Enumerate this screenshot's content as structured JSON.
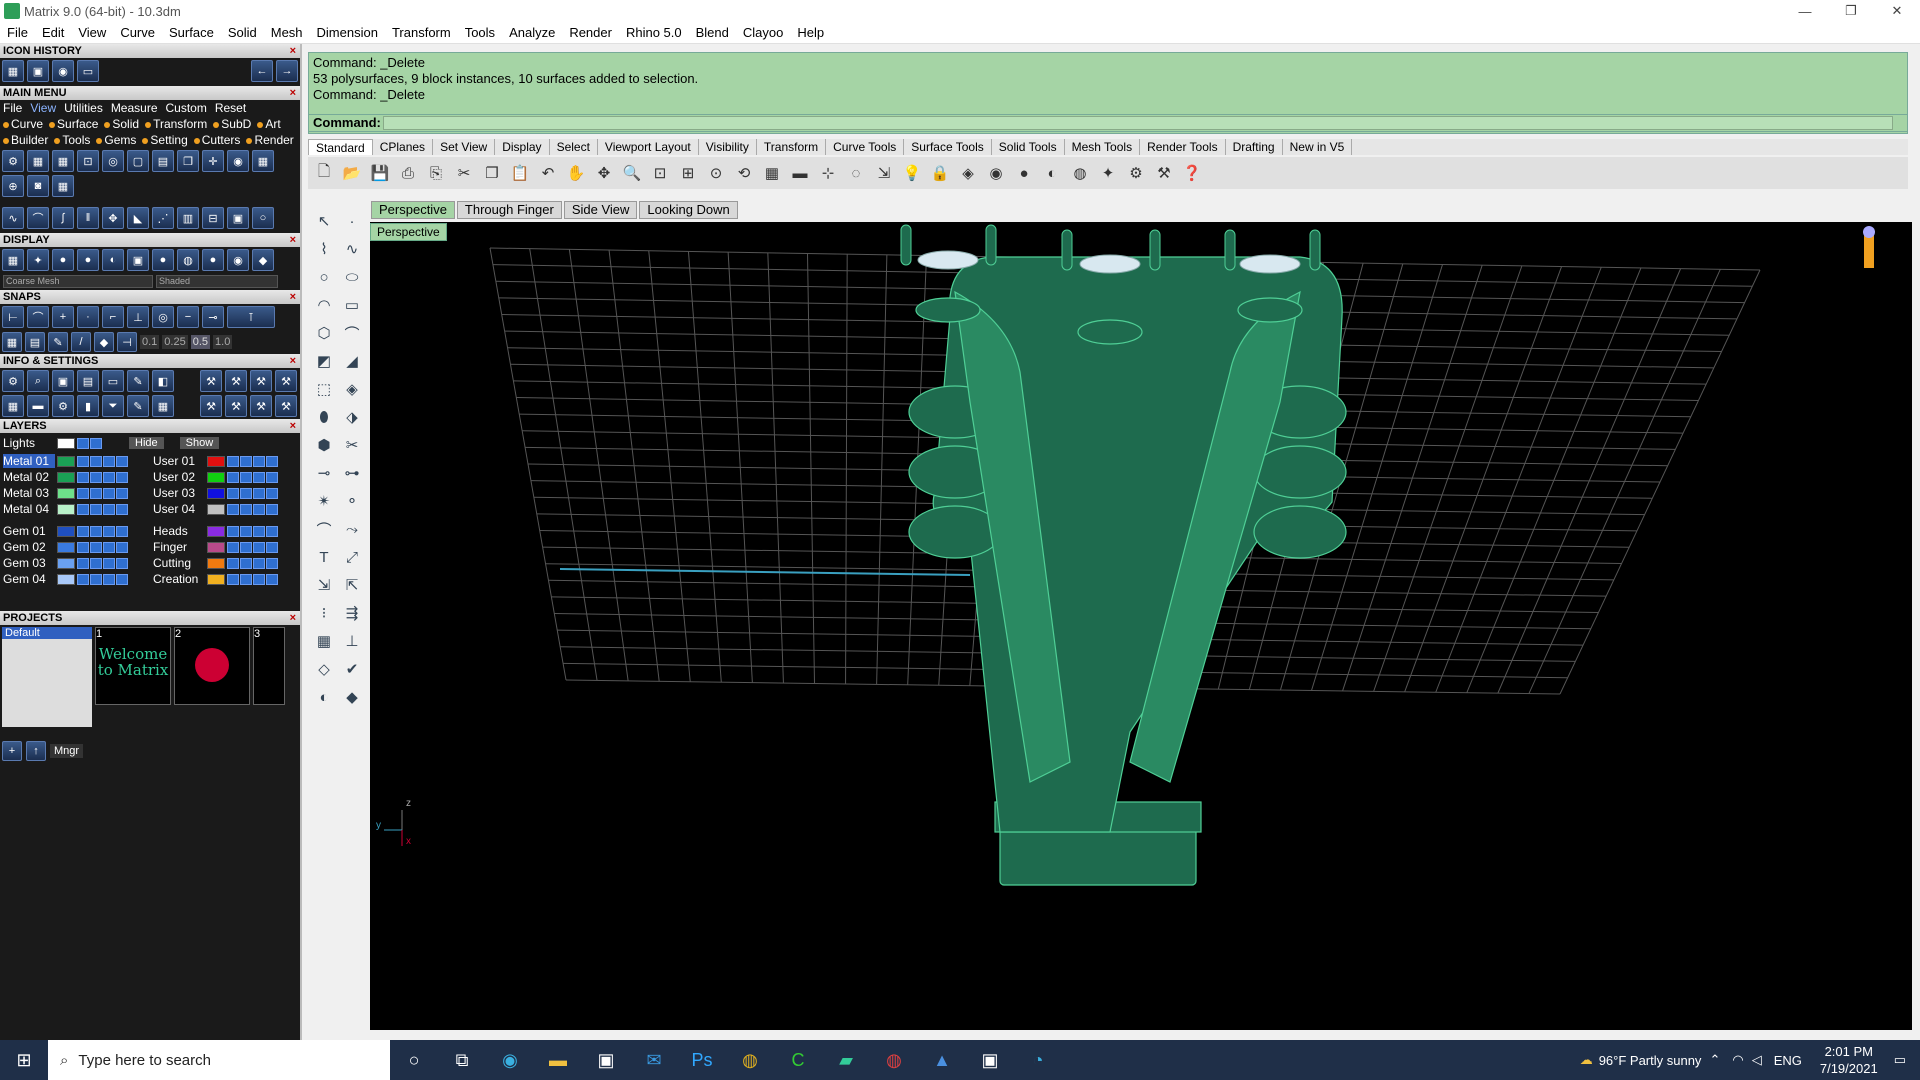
{
  "window": {
    "title": "Matrix 9.0 (64-bit) - 10.3dm",
    "controls": [
      "—",
      "❐",
      "✕"
    ]
  },
  "menubar": [
    "File",
    "Edit",
    "View",
    "Curve",
    "Surface",
    "Solid",
    "Mesh",
    "Dimension",
    "Transform",
    "Tools",
    "Analyze",
    "Render",
    "Rhino 5.0",
    "Blend",
    "Clayoo",
    "Help"
  ],
  "left": {
    "icon_history": "ICON HISTORY",
    "main_menu": "MAIN MENU",
    "mm_tabs": [
      "File",
      "View",
      "Utilities",
      "Measure",
      "Custom",
      "Reset"
    ],
    "mm_row1": [
      "Curve",
      "Surface",
      "Solid",
      "Transform",
      "SubD",
      "Art"
    ],
    "mm_row2": [
      "Builder",
      "Tools",
      "Gems",
      "Setting",
      "Cutters",
      "Render"
    ],
    "display": "DISPLAY",
    "display_mesh": "Coarse Mesh",
    "display_mode": "Shaded",
    "snaps": "SNAPS",
    "snap_values": [
      "0.1",
      "0.25",
      "0.5",
      "1.0"
    ],
    "info_settings": "INFO & SETTINGS",
    "layers_title": "LAYERS",
    "lights": "Lights",
    "hide": "Hide",
    "show": "Show",
    "layers_left": [
      {
        "name": "Metal 01",
        "color": "#1aa055",
        "sel": true
      },
      {
        "name": "Metal 02",
        "color": "#1aa055"
      },
      {
        "name": "Metal 03",
        "color": "#6ee08a"
      },
      {
        "name": "Metal 04",
        "color": "#b8f0c8"
      },
      {
        "name": "Gem 01",
        "color": "#1f4fc0"
      },
      {
        "name": "Gem 02",
        "color": "#3a7ae0"
      },
      {
        "name": "Gem 03",
        "color": "#6aa0f0"
      },
      {
        "name": "Gem 04",
        "color": "#a8c8f8"
      }
    ],
    "layers_right": [
      {
        "name": "User 01",
        "color": "#e01010"
      },
      {
        "name": "User 02",
        "color": "#10d010"
      },
      {
        "name": "User 03",
        "color": "#1010e0"
      },
      {
        "name": "User 04",
        "color": "#c0c0c0"
      },
      {
        "name": "Heads",
        "color": "#8a2be2"
      },
      {
        "name": "Finger",
        "color": "#b84a8a"
      },
      {
        "name": "Cutting",
        "color": "#f07a10"
      },
      {
        "name": "Creation",
        "color": "#f0b020"
      }
    ],
    "projects": "PROJECTS",
    "project_default": "Default",
    "thumbs": [
      "1",
      "2",
      "3"
    ],
    "welcome": "Welcome to Matrix",
    "mngr": "Mngr"
  },
  "command": {
    "lines": [
      "Command: _Delete",
      "53 polysurfaces, 9 block instances, 10 surfaces added to selection.",
      "Command: _Delete"
    ],
    "prompt": "Command:"
  },
  "toolbar_tabs": [
    "Standard",
    "CPlanes",
    "Set View",
    "Display",
    "Select",
    "Viewport Layout",
    "Visibility",
    "Transform",
    "Curve Tools",
    "Surface Tools",
    "Solid Tools",
    "Mesh Tools",
    "Render Tools",
    "Drafting",
    "New in V5"
  ],
  "view_tabs": [
    "Perspective",
    "Through Finger",
    "Side View",
    "Looking Down"
  ],
  "viewport_label": "Perspective",
  "axes": {
    "z": "z",
    "y": "y",
    "x": "x"
  },
  "taskbar": {
    "search": "Type here to search",
    "weather": "96°F  Partly sunny",
    "lang": "ENG",
    "time": "2:01 PM",
    "date": "7/19/2021"
  }
}
